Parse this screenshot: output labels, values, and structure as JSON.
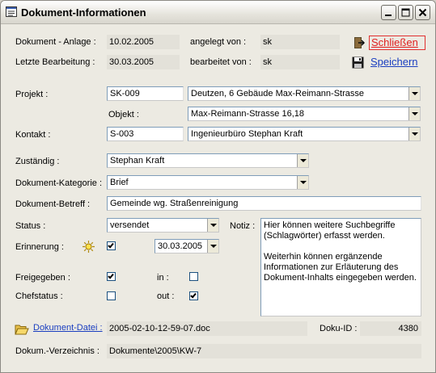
{
  "window": {
    "title": "Dokument-Informationen"
  },
  "actions": {
    "close_label": "Schließen",
    "save_label": "Speichern"
  },
  "header": {
    "anlage_label": "Dokument - Anlage :",
    "anlage_value": "10.02.2005",
    "angelegt_label": "angelegt von :",
    "angelegt_value": "sk",
    "bearbeitung_label": "Letzte Bearbeitung :",
    "bearbeitung_value": "30.03.2005",
    "bearbeitet_label": "bearbeitet von :",
    "bearbeitet_value": "sk"
  },
  "projekt": {
    "label": "Projekt :",
    "code": "SK-009",
    "name": "Deutzen, 6 Gebäude Max-Reimann-Strasse",
    "objekt_label": "Objekt :",
    "objekt_value": "Max-Reimann-Strasse 16,18"
  },
  "kontakt": {
    "label": "Kontakt :",
    "code": "S-003",
    "name": "Ingenieurbüro Stephan Kraft"
  },
  "zustaendig": {
    "label": "Zuständig :",
    "value": "Stephan Kraft"
  },
  "kategorie": {
    "label": "Dokument-Kategorie :",
    "value": "Brief"
  },
  "betreff": {
    "label": "Dokument-Betreff :",
    "value": "Gemeinde wg. Straßenreinigung"
  },
  "status": {
    "label": "Status :",
    "value": "versendet"
  },
  "notiz": {
    "label": "Notiz :",
    "text": "Hier können weitere Suchbegriffe (Schlagwörter) erfasst werden.\n\nWeiterhin können ergänzende Informationen zur Erläuterung des Dokument-Inhalts eingegeben werden."
  },
  "erinnerung": {
    "label": "Erinnerung :",
    "checked": true,
    "date": "30.03.2005"
  },
  "freigegeben": {
    "label": "Freigegeben :",
    "checked": true,
    "in_label": "in :",
    "in_checked": false
  },
  "chefstatus": {
    "label": "Chefstatus :",
    "checked": false,
    "out_label": "out :",
    "out_checked": true
  },
  "datei": {
    "link_label": "Dokument-Datei :",
    "value": "2005-02-10-12-59-07.doc",
    "docid_label": "Doku-ID :",
    "docid_value": "4380"
  },
  "verzeichnis": {
    "label": "Dokum.-Verzeichnis :",
    "value": "Dokumente\\2005\\KW-7"
  }
}
